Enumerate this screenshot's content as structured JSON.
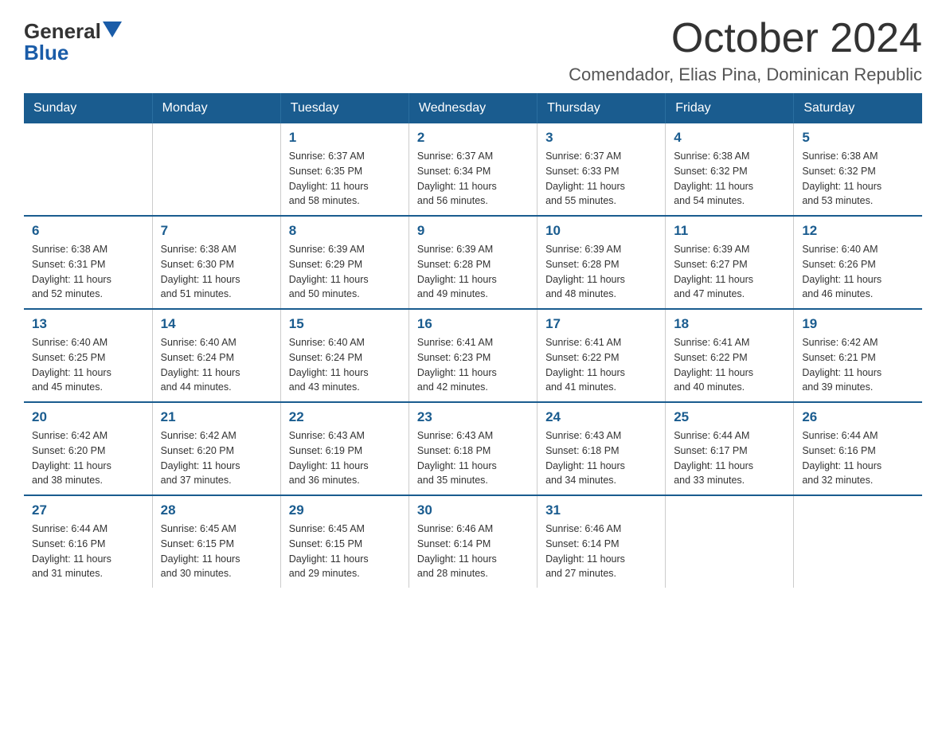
{
  "logo": {
    "text_general": "General",
    "text_blue": "Blue"
  },
  "title": {
    "month_year": "October 2024",
    "location": "Comendador, Elias Pina, Dominican Republic"
  },
  "days_of_week": [
    "Sunday",
    "Monday",
    "Tuesday",
    "Wednesday",
    "Thursday",
    "Friday",
    "Saturday"
  ],
  "weeks": [
    [
      {
        "day": "",
        "info": ""
      },
      {
        "day": "",
        "info": ""
      },
      {
        "day": "1",
        "info": "Sunrise: 6:37 AM\nSunset: 6:35 PM\nDaylight: 11 hours\nand 58 minutes."
      },
      {
        "day": "2",
        "info": "Sunrise: 6:37 AM\nSunset: 6:34 PM\nDaylight: 11 hours\nand 56 minutes."
      },
      {
        "day": "3",
        "info": "Sunrise: 6:37 AM\nSunset: 6:33 PM\nDaylight: 11 hours\nand 55 minutes."
      },
      {
        "day": "4",
        "info": "Sunrise: 6:38 AM\nSunset: 6:32 PM\nDaylight: 11 hours\nand 54 minutes."
      },
      {
        "day": "5",
        "info": "Sunrise: 6:38 AM\nSunset: 6:32 PM\nDaylight: 11 hours\nand 53 minutes."
      }
    ],
    [
      {
        "day": "6",
        "info": "Sunrise: 6:38 AM\nSunset: 6:31 PM\nDaylight: 11 hours\nand 52 minutes."
      },
      {
        "day": "7",
        "info": "Sunrise: 6:38 AM\nSunset: 6:30 PM\nDaylight: 11 hours\nand 51 minutes."
      },
      {
        "day": "8",
        "info": "Sunrise: 6:39 AM\nSunset: 6:29 PM\nDaylight: 11 hours\nand 50 minutes."
      },
      {
        "day": "9",
        "info": "Sunrise: 6:39 AM\nSunset: 6:28 PM\nDaylight: 11 hours\nand 49 minutes."
      },
      {
        "day": "10",
        "info": "Sunrise: 6:39 AM\nSunset: 6:28 PM\nDaylight: 11 hours\nand 48 minutes."
      },
      {
        "day": "11",
        "info": "Sunrise: 6:39 AM\nSunset: 6:27 PM\nDaylight: 11 hours\nand 47 minutes."
      },
      {
        "day": "12",
        "info": "Sunrise: 6:40 AM\nSunset: 6:26 PM\nDaylight: 11 hours\nand 46 minutes."
      }
    ],
    [
      {
        "day": "13",
        "info": "Sunrise: 6:40 AM\nSunset: 6:25 PM\nDaylight: 11 hours\nand 45 minutes."
      },
      {
        "day": "14",
        "info": "Sunrise: 6:40 AM\nSunset: 6:24 PM\nDaylight: 11 hours\nand 44 minutes."
      },
      {
        "day": "15",
        "info": "Sunrise: 6:40 AM\nSunset: 6:24 PM\nDaylight: 11 hours\nand 43 minutes."
      },
      {
        "day": "16",
        "info": "Sunrise: 6:41 AM\nSunset: 6:23 PM\nDaylight: 11 hours\nand 42 minutes."
      },
      {
        "day": "17",
        "info": "Sunrise: 6:41 AM\nSunset: 6:22 PM\nDaylight: 11 hours\nand 41 minutes."
      },
      {
        "day": "18",
        "info": "Sunrise: 6:41 AM\nSunset: 6:22 PM\nDaylight: 11 hours\nand 40 minutes."
      },
      {
        "day": "19",
        "info": "Sunrise: 6:42 AM\nSunset: 6:21 PM\nDaylight: 11 hours\nand 39 minutes."
      }
    ],
    [
      {
        "day": "20",
        "info": "Sunrise: 6:42 AM\nSunset: 6:20 PM\nDaylight: 11 hours\nand 38 minutes."
      },
      {
        "day": "21",
        "info": "Sunrise: 6:42 AM\nSunset: 6:20 PM\nDaylight: 11 hours\nand 37 minutes."
      },
      {
        "day": "22",
        "info": "Sunrise: 6:43 AM\nSunset: 6:19 PM\nDaylight: 11 hours\nand 36 minutes."
      },
      {
        "day": "23",
        "info": "Sunrise: 6:43 AM\nSunset: 6:18 PM\nDaylight: 11 hours\nand 35 minutes."
      },
      {
        "day": "24",
        "info": "Sunrise: 6:43 AM\nSunset: 6:18 PM\nDaylight: 11 hours\nand 34 minutes."
      },
      {
        "day": "25",
        "info": "Sunrise: 6:44 AM\nSunset: 6:17 PM\nDaylight: 11 hours\nand 33 minutes."
      },
      {
        "day": "26",
        "info": "Sunrise: 6:44 AM\nSunset: 6:16 PM\nDaylight: 11 hours\nand 32 minutes."
      }
    ],
    [
      {
        "day": "27",
        "info": "Sunrise: 6:44 AM\nSunset: 6:16 PM\nDaylight: 11 hours\nand 31 minutes."
      },
      {
        "day": "28",
        "info": "Sunrise: 6:45 AM\nSunset: 6:15 PM\nDaylight: 11 hours\nand 30 minutes."
      },
      {
        "day": "29",
        "info": "Sunrise: 6:45 AM\nSunset: 6:15 PM\nDaylight: 11 hours\nand 29 minutes."
      },
      {
        "day": "30",
        "info": "Sunrise: 6:46 AM\nSunset: 6:14 PM\nDaylight: 11 hours\nand 28 minutes."
      },
      {
        "day": "31",
        "info": "Sunrise: 6:46 AM\nSunset: 6:14 PM\nDaylight: 11 hours\nand 27 minutes."
      },
      {
        "day": "",
        "info": ""
      },
      {
        "day": "",
        "info": ""
      }
    ]
  ]
}
